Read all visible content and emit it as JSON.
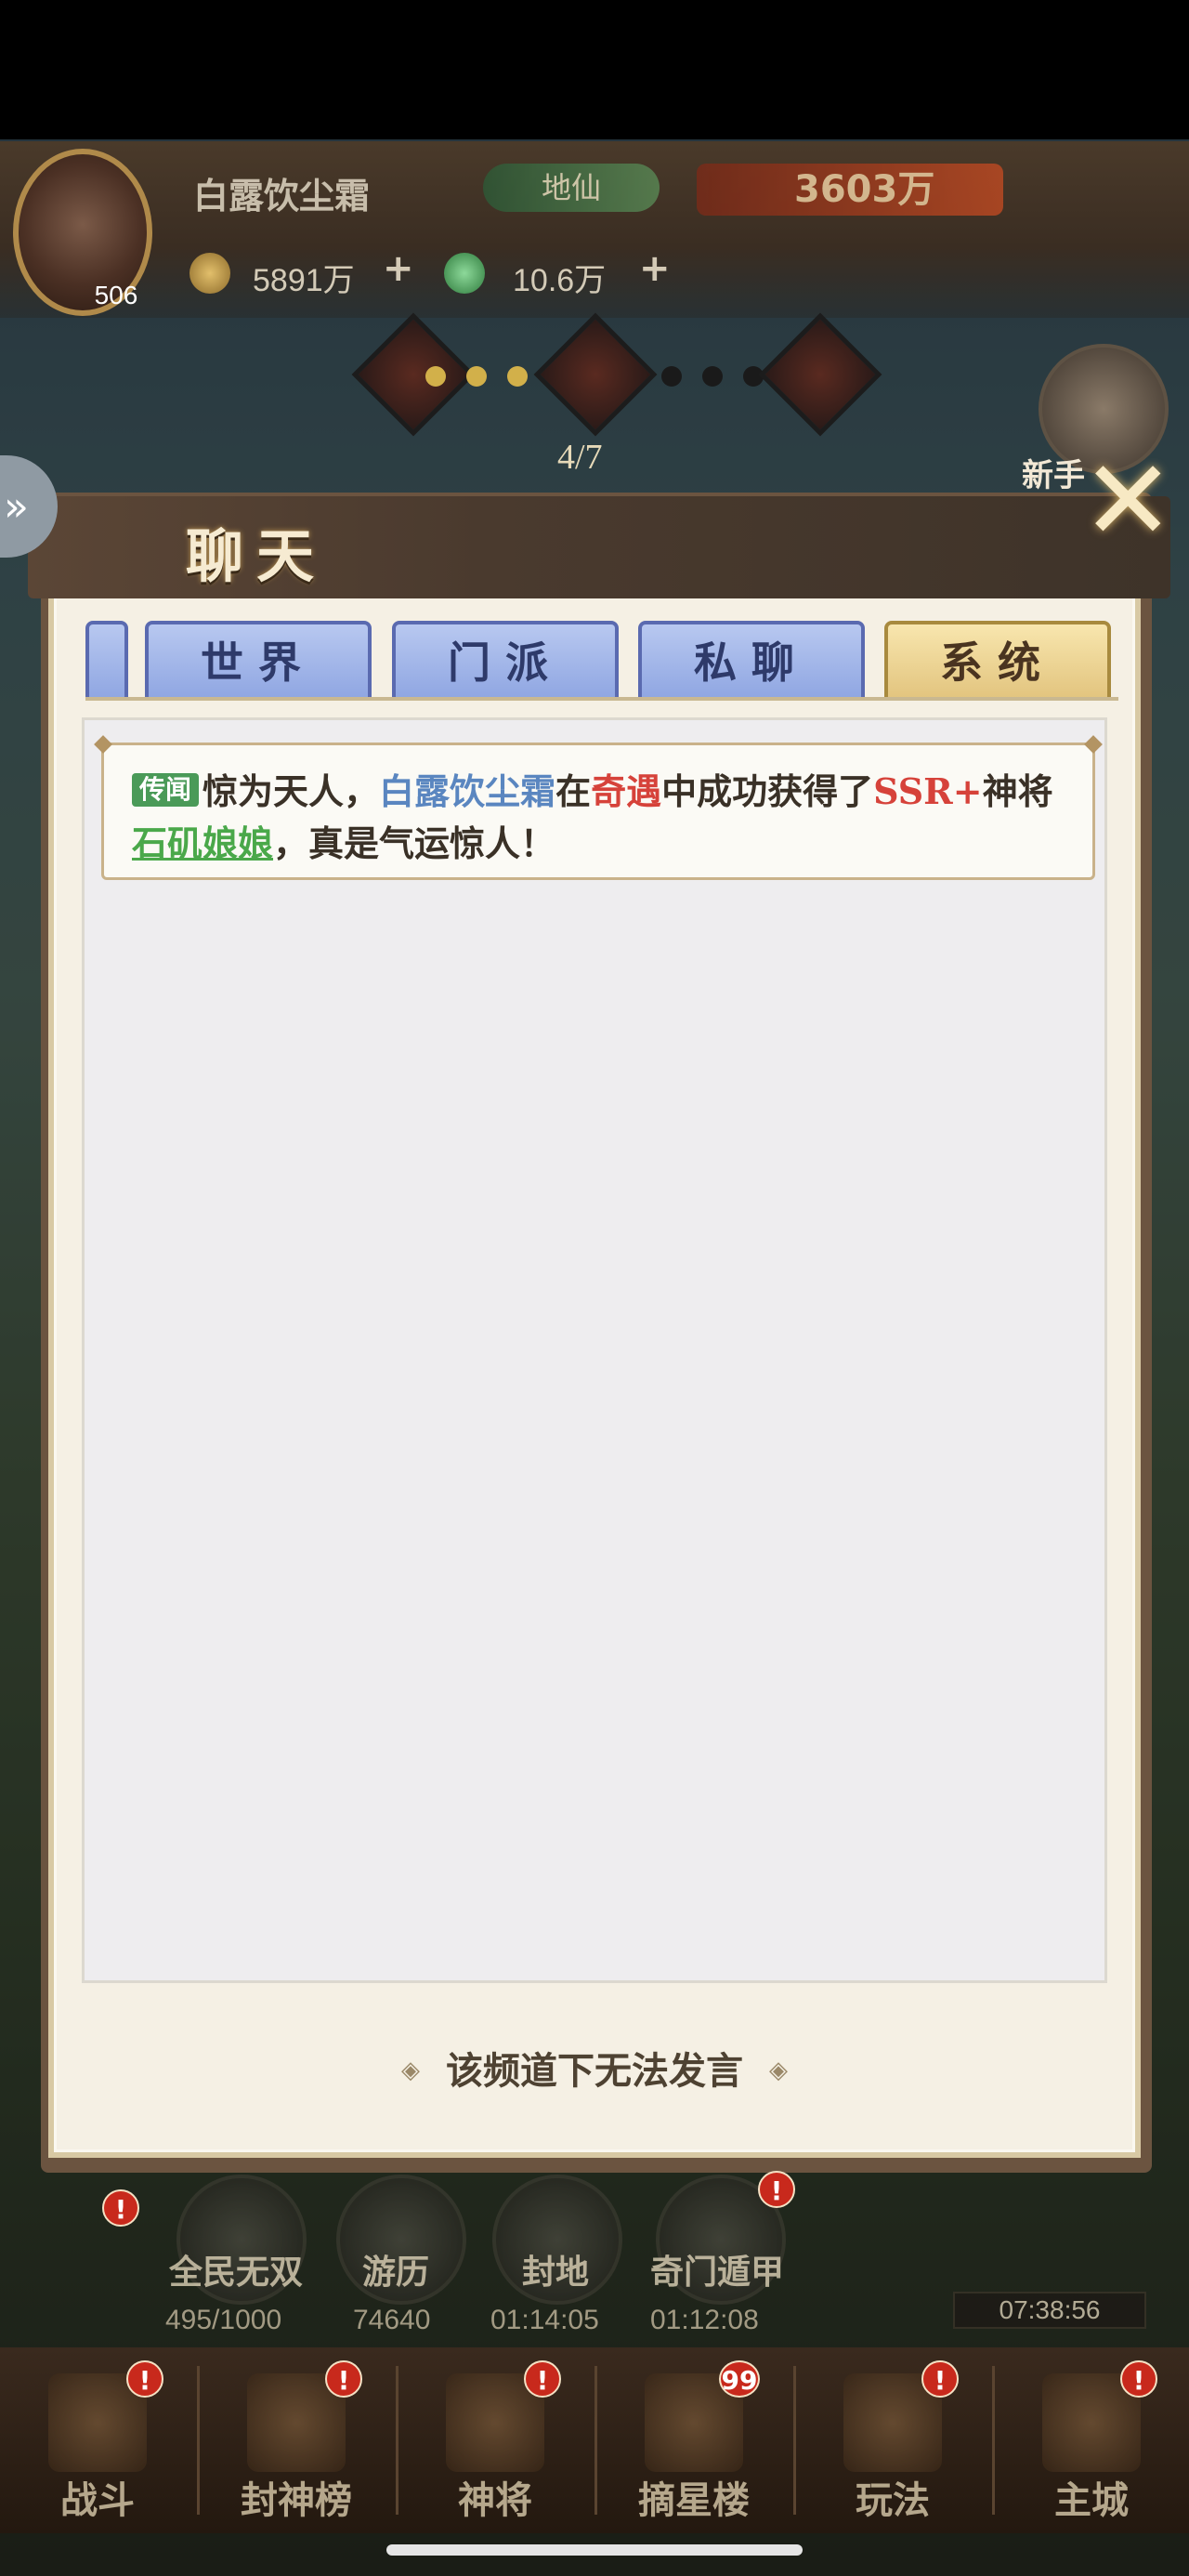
{
  "player": {
    "name": "白露饮尘霜",
    "level": "506",
    "rank": "地仙",
    "power": "3603万",
    "coins": "5891万",
    "jade": "10.6万",
    "plus": "+"
  },
  "stage": {
    "progress": "4/7"
  },
  "newbie": {
    "label": "新手"
  },
  "chat": {
    "title": "聊天",
    "close_glyph": "✕",
    "back_glyph": "»",
    "tabs": {
      "world": "世界",
      "sect": "门派",
      "private": "私聊",
      "system": "系统"
    },
    "active_tab": "system",
    "message": {
      "tag": "传闻",
      "part1": "惊为天人，",
      "player": "白露饮尘霜",
      "part2": "在",
      "event": "奇遇",
      "part3": "中成功获得了",
      "rarity": "SSR+",
      "part4": "神将",
      "hero": "石矶娘娘",
      "part5": "，真是气运惊人！"
    },
    "footer": "该频道下无法发言",
    "footer_deco": "◈"
  },
  "quick": {
    "q1": {
      "label": "全民无双",
      "timer": "495/1000"
    },
    "q2": {
      "label": "游历",
      "timer": "74640"
    },
    "q3": {
      "label": "封地",
      "timer": "01:14:05"
    },
    "q4": {
      "label": "奇门遁甲",
      "timer": "01:12:08"
    },
    "gift_timer": "07:38:56",
    "badge": "!"
  },
  "nav": {
    "battle": "战斗",
    "rank": "封神榜",
    "hero": "神将",
    "tower": "摘星楼",
    "play": "玩法",
    "city": "主城",
    "tower_badge": "99",
    "badge": "!"
  },
  "colors": {
    "tab_inactive": "#8fa6e2",
    "tab_active": "#e2c47e",
    "player_name": "#5a86c0",
    "highlight_red": "#d6423a",
    "hero_green": "#4aa84a"
  }
}
